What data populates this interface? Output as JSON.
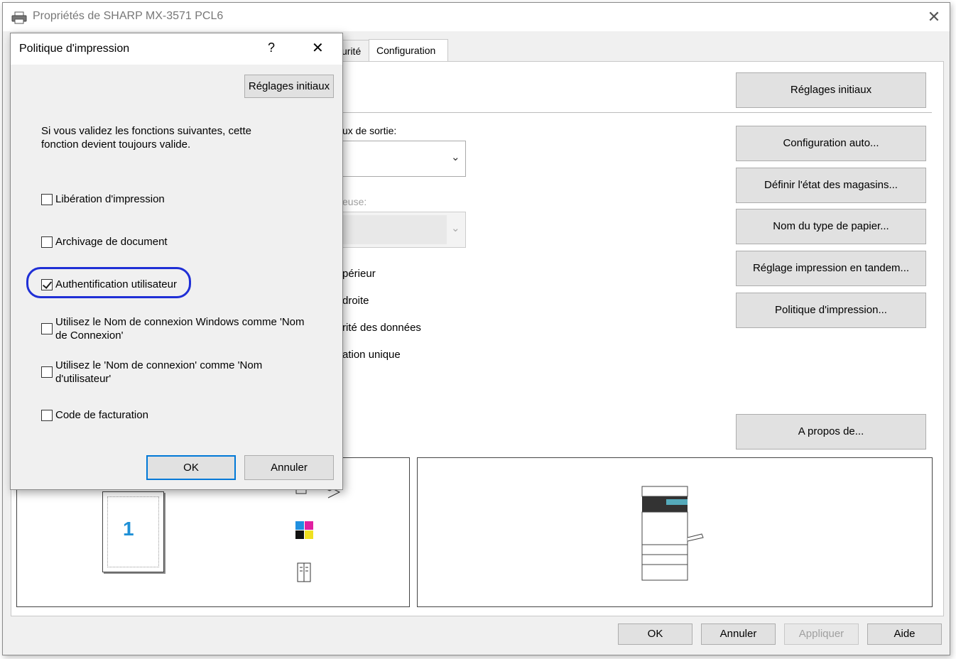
{
  "main_window": {
    "title": "Propriétés de SHARP MX-3571 PCL6",
    "tabs": [
      "urité",
      "Configuration"
    ],
    "buttons": {
      "reglages_initiaux": "Réglages initiaux",
      "configuration_auto": "Configuration auto...",
      "definir_magasins": "Définir l'état des magasins...",
      "nom_type_papier": "Nom du type de papier...",
      "reglage_tandem": "Réglage impression en tandem...",
      "politique_impression": "Politique d'impression...",
      "a_propos": "A propos de..."
    },
    "partial_labels": {
      "sortie": "ux de sortie:",
      "euse": "euse:",
      "superieur": "périeur",
      "droite": "droite",
      "donnees": "rité des données",
      "unique": "ation unique"
    },
    "preview_page_number": "1",
    "footer_buttons": {
      "ok": "OK",
      "annuler": "Annuler",
      "appliquer": "Appliquer",
      "aide": "Aide"
    }
  },
  "dialog": {
    "title": "Politique d'impression",
    "help": "?",
    "close": "✕",
    "reset_button": "Réglages initiaux",
    "description_line1": "Si vous validez les fonctions suivantes, cette",
    "description_line2": "fonction devient toujours valide.",
    "options": [
      {
        "label": "Libération d'impression",
        "checked": false
      },
      {
        "label": "Archivage de document",
        "checked": false
      },
      {
        "label": "Authentification utilisateur",
        "checked": true
      },
      {
        "label_line1": "Utilisez le Nom de connexion Windows comme 'Nom",
        "label_line2": "de Connexion'",
        "checked": false
      },
      {
        "label_line1": "Utilisez le 'Nom de connexion' comme 'Nom",
        "label_line2": "d'utilisateur'",
        "checked": false
      },
      {
        "label": "Code de facturation",
        "checked": false
      }
    ],
    "ok": "OK",
    "cancel": "Annuler"
  },
  "colors": {
    "highlight": "#1f2fd6",
    "focus_border": "#0078d7",
    "disabled_text": "#a0a0a0",
    "page_number": "#1e90d6"
  }
}
